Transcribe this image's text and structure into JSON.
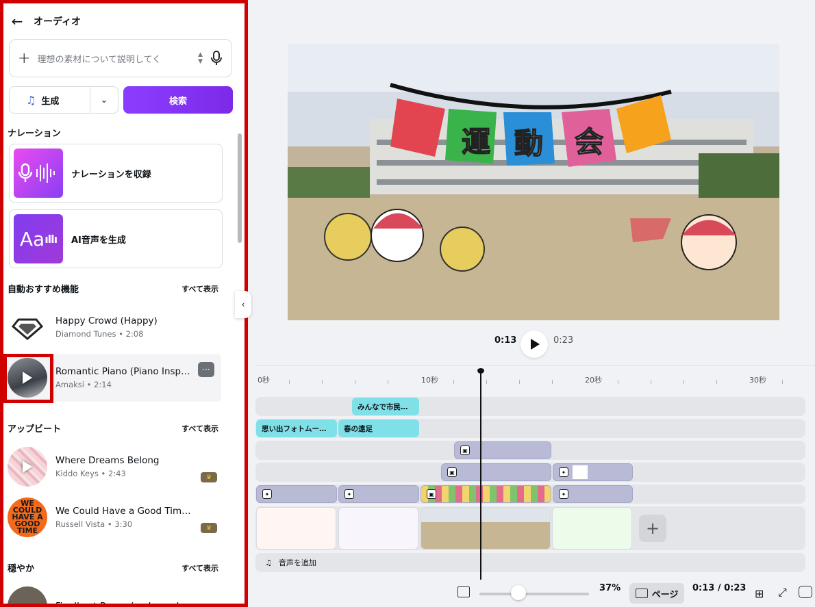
{
  "panel": {
    "title": "オーディオ",
    "search_placeholder": "理想の素材について説明してく",
    "generate_label": "生成",
    "search_button": "検索",
    "narration": {
      "heading": "ナレーション",
      "record_label": "ナレーションを収録",
      "ai_label": "AI音声を生成",
      "ai_icon_text": "Aa"
    },
    "sections": [
      {
        "heading": "自動おすすめ機能",
        "show_all": "すべて表示"
      },
      {
        "heading": "アップビート",
        "show_all": "すべて表示"
      },
      {
        "heading": "穏やか",
        "show_all": "すべて表示"
      }
    ],
    "tracks": [
      {
        "name": "Happy Crowd (Happy)",
        "sub": "Diamond Tunes • 2:08"
      },
      {
        "name": "Romantic Piano (Piano Inspi…",
        "sub": "Amaksi • 2:14",
        "more": "···"
      },
      {
        "name": "Where Dreams Belong",
        "sub": "Kiddo Keys • 2:43"
      },
      {
        "name": "We Could Have a Good Time (Inst…",
        "sub": "Russell Vista • 3:30",
        "art_text": "WE COULD HAVE A GOOD TIME"
      },
      {
        "name": "Finally at Peace (no bowed bowls…",
        "sub": ""
      }
    ]
  },
  "canvas": {
    "banner_text": [
      "運",
      "動",
      "会"
    ]
  },
  "playback": {
    "current": "0:13",
    "total": "0:23"
  },
  "timeline": {
    "ticks": [
      "0秒",
      "10秒",
      "20秒",
      "30秒"
    ],
    "clips": {
      "row1": "みんなで市民…",
      "row2a": "思い出フォトムー…",
      "row2b": "春の遠足"
    },
    "add_audio": "音声を追加"
  },
  "footer": {
    "zoom": "37%",
    "page_label": "ページ",
    "time": "0:13 / 0:23"
  },
  "colors": {
    "accent": "#8b3dff",
    "highlight": "#d10000",
    "text_clip": "#7fe0e8"
  }
}
